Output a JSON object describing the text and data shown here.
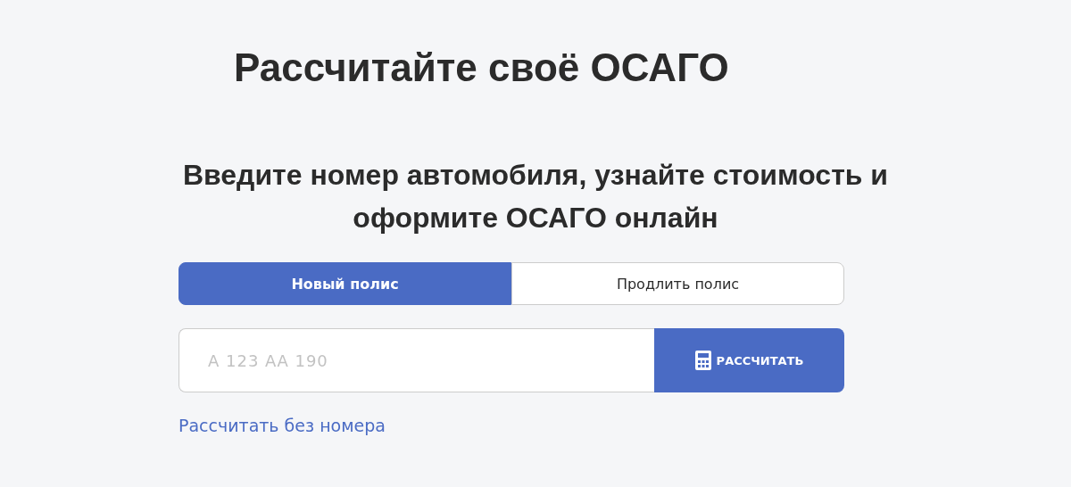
{
  "title": "Рассчитайте своё ОСАГО",
  "subtitle": "Введите номер автомобиля, узнайте стоимость и оформите ОСАГО онлайн",
  "tabs": [
    {
      "label": "Новый полис",
      "selected": true
    },
    {
      "label": "Продлить полис",
      "selected": false
    }
  ],
  "plate_field": {
    "placeholder": "А 123 АА 190"
  },
  "calculate_button": "РАССЧИТАТЬ",
  "no_plate_link": "Рассчитать без номера"
}
